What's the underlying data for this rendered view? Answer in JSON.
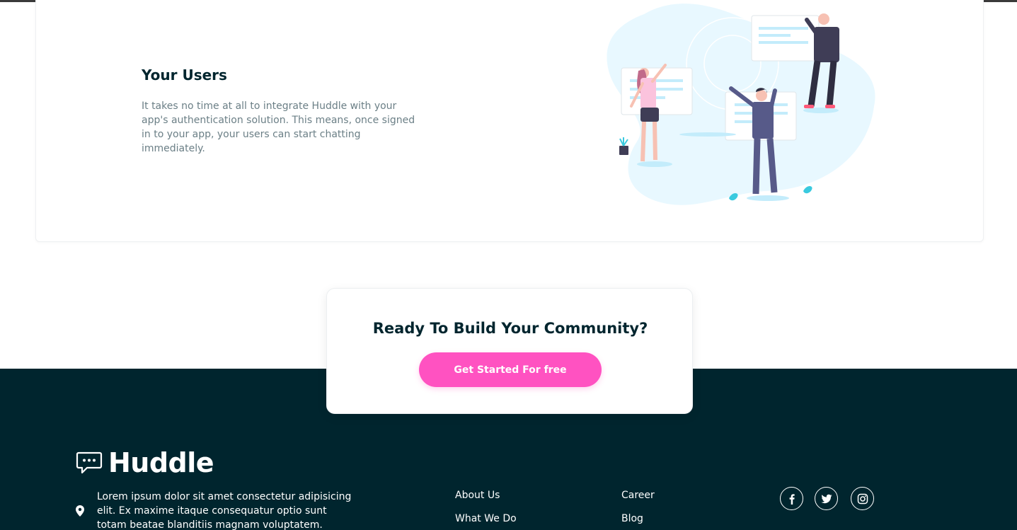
{
  "feature": {
    "title": "Your Users",
    "text": "It takes no time at all to integrate Huddle with your app's authentication solution. This means, once signed in to your app, your users can start chatting immediately."
  },
  "cta": {
    "title": "Ready To Build Your Community?",
    "button_label": "Get Started For free"
  },
  "footer": {
    "brand": "Huddle",
    "address": "Lorem ipsum dolor sit amet consectetur adipisicing elit. Ex maxime itaque consequatur optio sunt totam beatae blanditiis magnam voluptatem.",
    "links_col1": [
      "About Us",
      "What We Do"
    ],
    "links_col2": [
      "Career",
      "Blog"
    ],
    "social": [
      {
        "icon": "facebook-icon"
      },
      {
        "icon": "twitter-icon"
      },
      {
        "icon": "instagram-icon"
      }
    ]
  },
  "colors": {
    "dark": "#00252e",
    "accent_pink": "#ff52c1",
    "muted_text": "#6b7f86",
    "light_blue": "#e8f8ff"
  }
}
